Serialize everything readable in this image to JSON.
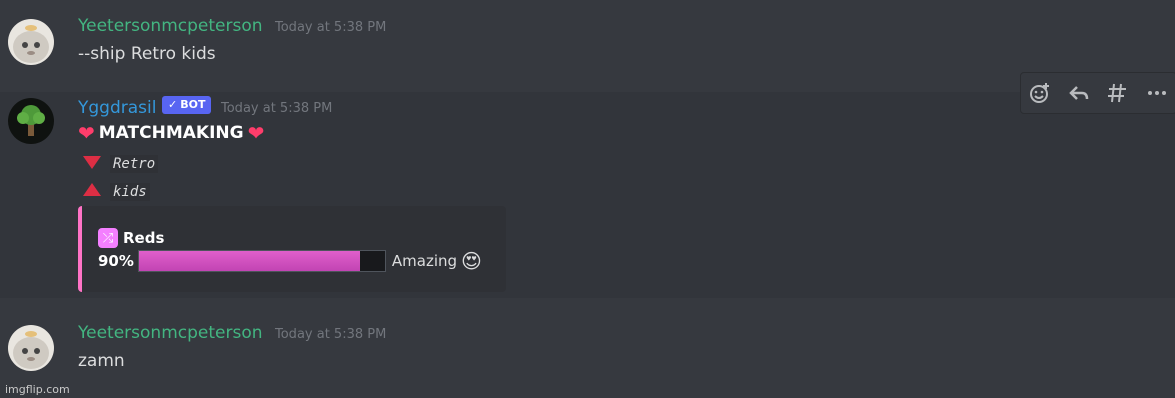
{
  "messages": [
    {
      "username": "Yeetersonmcpeterson",
      "timestamp": "Today at 5:38 PM",
      "text": "--ship Retro kids",
      "name_color": "#43b581"
    },
    {
      "username": "Yggdrasil",
      "badge": "BOT",
      "timestamp": "Today at 5:38 PM",
      "name_color": "#3498db",
      "title": "MATCHMAKING",
      "down_name": "Retro",
      "up_name": "kids",
      "embed": {
        "title": "Reds",
        "percent_text": "90%",
        "progress": 0.9,
        "rating": "Amazing",
        "accent": "#ff73c6"
      }
    },
    {
      "username": "Yeetersonmcpeterson",
      "timestamp": "Today at 5:38 PM",
      "text": "zamn",
      "name_color": "#43b581"
    }
  ],
  "toolbar": {
    "icons": [
      "add-reaction-icon",
      "reply-icon",
      "create-thread-icon",
      "more-icon"
    ]
  },
  "watermark": "imgflip.com"
}
